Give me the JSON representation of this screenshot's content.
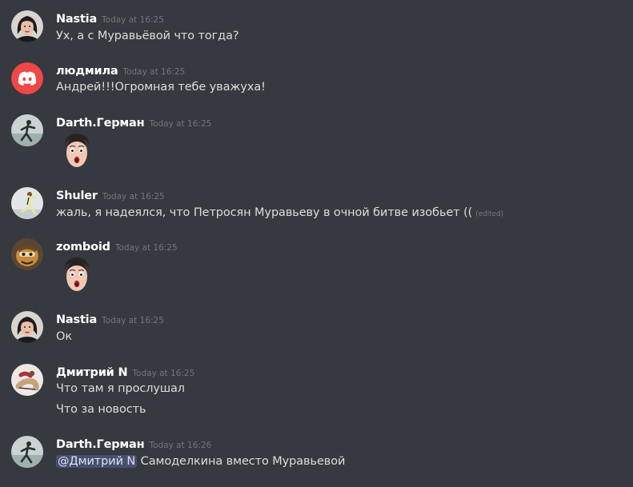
{
  "colors": {
    "background": "#36393f",
    "username": "#ffffff",
    "text": "#dcddde",
    "timestamp": "#72767d",
    "mention_bg": "#4c5582",
    "discord_red": "#f04747"
  },
  "messages": [
    {
      "username": "Nastia",
      "timestamp": "Today at 16:25",
      "avatar_icon": "woman-portrait-icon",
      "lines": [
        "Ух, а с Муравьёвой что тогда?"
      ]
    },
    {
      "username": "людмила",
      "timestamp": "Today at 16:25",
      "avatar_icon": "discord-logo-icon",
      "lines": [
        "Андрей!!!Огромная тебе уважуха!"
      ]
    },
    {
      "username": "Darth.Герман",
      "timestamp": "Today at 16:25",
      "avatar_icon": "skater-icon",
      "emoji": "surprised-face-emoji"
    },
    {
      "username": "Shuler",
      "timestamp": "Today at 16:25",
      "avatar_icon": "skater-icon",
      "lines": [
        "жаль, я надеялся, что Петросян Муравьеву в очной битве изобьет (("
      ],
      "edited": "(edited)"
    },
    {
      "username": "zomboid",
      "timestamp": "Today at 16:25",
      "avatar_icon": "cartoon-character-icon",
      "emoji": "surprised-face-emoji"
    },
    {
      "username": "Nastia",
      "timestamp": "Today at 16:25",
      "avatar_icon": "woman-portrait-icon",
      "lines": [
        "Ок"
      ]
    },
    {
      "username": "Дмитрий N",
      "timestamp": "Today at 16:25",
      "avatar_icon": "skater-icon",
      "lines": [
        "Что там я прослушал",
        "Что за новость"
      ]
    },
    {
      "username": "Darth.Герман",
      "timestamp": "Today at 16:26",
      "avatar_icon": "skater-icon",
      "mention": "@Дмитрий N",
      "lines": [
        "Самоделкина вместо Муравьевой"
      ]
    }
  ]
}
